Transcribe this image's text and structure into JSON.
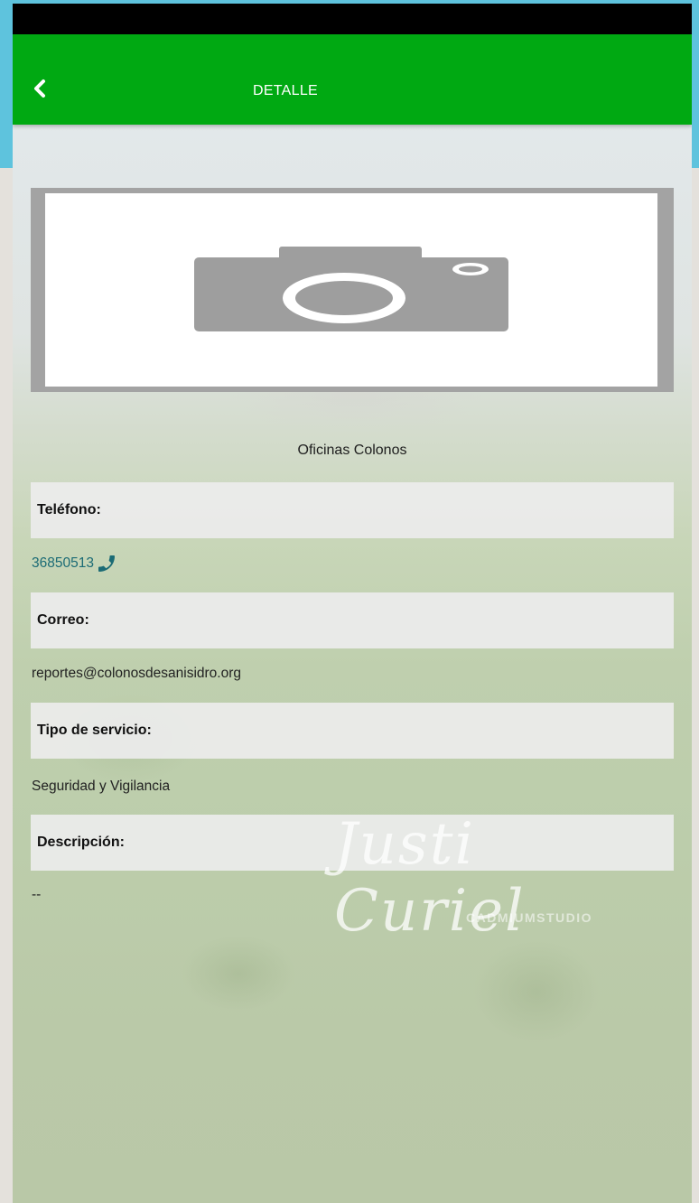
{
  "app_bar": {
    "title": "DETALLE",
    "background_color": "#00a912",
    "back_icon": "chevron-left-icon"
  },
  "image_placeholder": {
    "icon": "camera-icon"
  },
  "place_name": "Oficinas Colonos",
  "fields": {
    "phone_label": "Teléfono:",
    "phone_value": "36850513",
    "phone_icon": "phone-icon",
    "email_label": "Correo:",
    "email_value": "reportes@colonosdesanisidro.org",
    "service_label": "Tipo de servicio:",
    "service_value": "Seguridad y Vigilancia",
    "description_label": "Descripción:",
    "description_value": "--"
  },
  "watermark": {
    "signature": "Justi Curiel",
    "studio": "CADMIUMSTUDIO"
  },
  "colors": {
    "link": "#1b6b75",
    "label_band": "#ececec",
    "outer_backdrop": "#5ec3dd"
  }
}
